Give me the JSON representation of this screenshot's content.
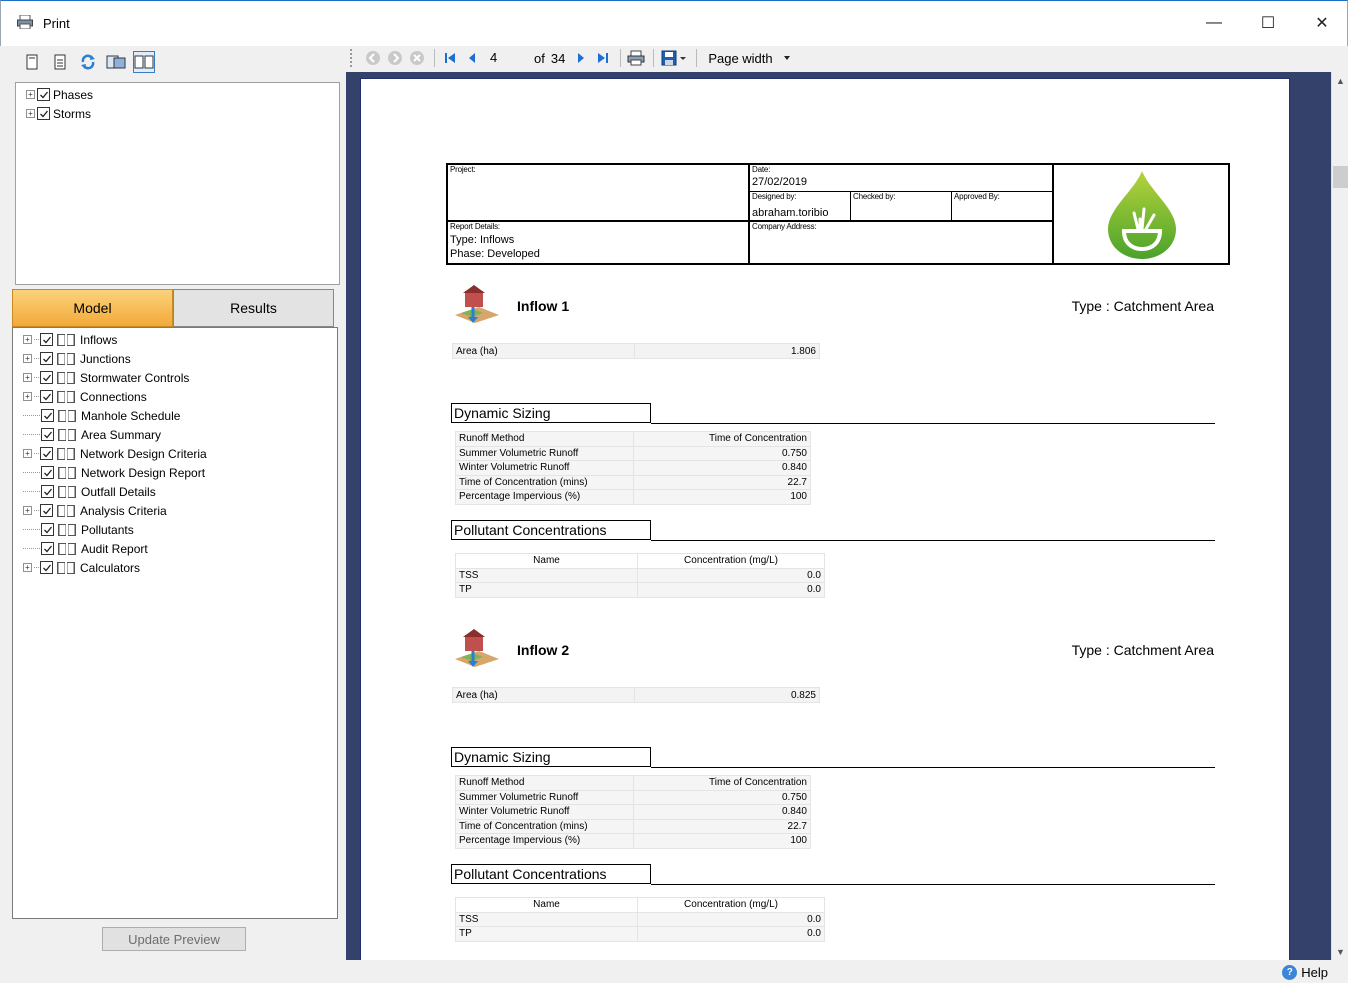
{
  "window": {
    "title": "Print",
    "minimize": "—",
    "maximize": "☐",
    "close": "✕"
  },
  "left": {
    "top_tree": [
      {
        "label": "Phases",
        "expand": "+"
      },
      {
        "label": "Storms",
        "expand": "+"
      }
    ],
    "tabs": {
      "model": "Model",
      "results": "Results"
    },
    "model_tree": [
      {
        "label": "Inflows",
        "expand": "+"
      },
      {
        "label": "Junctions",
        "expand": "+"
      },
      {
        "label": "Stormwater Controls",
        "expand": "+"
      },
      {
        "label": "Connections",
        "expand": "+"
      },
      {
        "label": "Manhole Schedule",
        "expand": ""
      },
      {
        "label": "Area Summary",
        "expand": ""
      },
      {
        "label": "Network Design Criteria",
        "expand": "+"
      },
      {
        "label": "Network Design Report",
        "expand": ""
      },
      {
        "label": "Outfall Details",
        "expand": ""
      },
      {
        "label": "Analysis Criteria",
        "expand": "+"
      },
      {
        "label": "Pollutants",
        "expand": ""
      },
      {
        "label": "Audit Report",
        "expand": ""
      },
      {
        "label": "Calculators",
        "expand": "+"
      }
    ],
    "update_button": "Update Preview"
  },
  "toolbar": {
    "current_page": "4",
    "of_label": "of",
    "total_pages": "34",
    "zoom": "Page width"
  },
  "report": {
    "header": {
      "project_label": "Project:",
      "date_label": "Date:",
      "date_value": "27/02/2019",
      "designed_label": "Designed by:",
      "designed_value": "abraham.toribio",
      "checked_label": "Checked by:",
      "approved_label": "Approved By:",
      "details_label": "Report Details:",
      "type_line": "Type: Inflows",
      "phase_line": "Phase: Developed",
      "company_label": "Company Address:"
    },
    "inflows": [
      {
        "title": "Inflow 1",
        "type": "Type : Catchment Area",
        "area_label": "Area (ha)",
        "area_value": "1.806",
        "dynamic_title": "Dynamic Sizing",
        "dynamic_rows": [
          [
            "Runoff Method",
            "Time of Concentration"
          ],
          [
            "Summer Volumetric Runoff",
            "0.750"
          ],
          [
            "Winter Volumetric Runoff",
            "0.840"
          ],
          [
            "Time of Concentration (mins)",
            "22.7"
          ],
          [
            "Percentage Impervious (%)",
            "100"
          ]
        ],
        "pollutant_title": "Pollutant Concentrations",
        "pollutant_headers": [
          "Name",
          "Concentration (mg/L)"
        ],
        "pollutant_rows": [
          [
            "TSS",
            "0.0"
          ],
          [
            "TP",
            "0.0"
          ]
        ]
      },
      {
        "title": "Inflow 2",
        "type": "Type : Catchment Area",
        "area_label": "Area (ha)",
        "area_value": "0.825",
        "dynamic_title": "Dynamic Sizing",
        "dynamic_rows": [
          [
            "Runoff Method",
            "Time of Concentration"
          ],
          [
            "Summer Volumetric Runoff",
            "0.750"
          ],
          [
            "Winter Volumetric Runoff",
            "0.840"
          ],
          [
            "Time of Concentration (mins)",
            "22.7"
          ],
          [
            "Percentage Impervious (%)",
            "100"
          ]
        ],
        "pollutant_title": "Pollutant Concentrations",
        "pollutant_headers": [
          "Name",
          "Concentration (mg/L)"
        ],
        "pollutant_rows": [
          [
            "TSS",
            "0.0"
          ],
          [
            "TP",
            "0.0"
          ]
        ]
      }
    ]
  },
  "status": {
    "help": "Help"
  },
  "colors": {
    "accent_tab": "#f3a93a",
    "preview_bg": "#34426b",
    "logo_green": "#6ab42d"
  }
}
